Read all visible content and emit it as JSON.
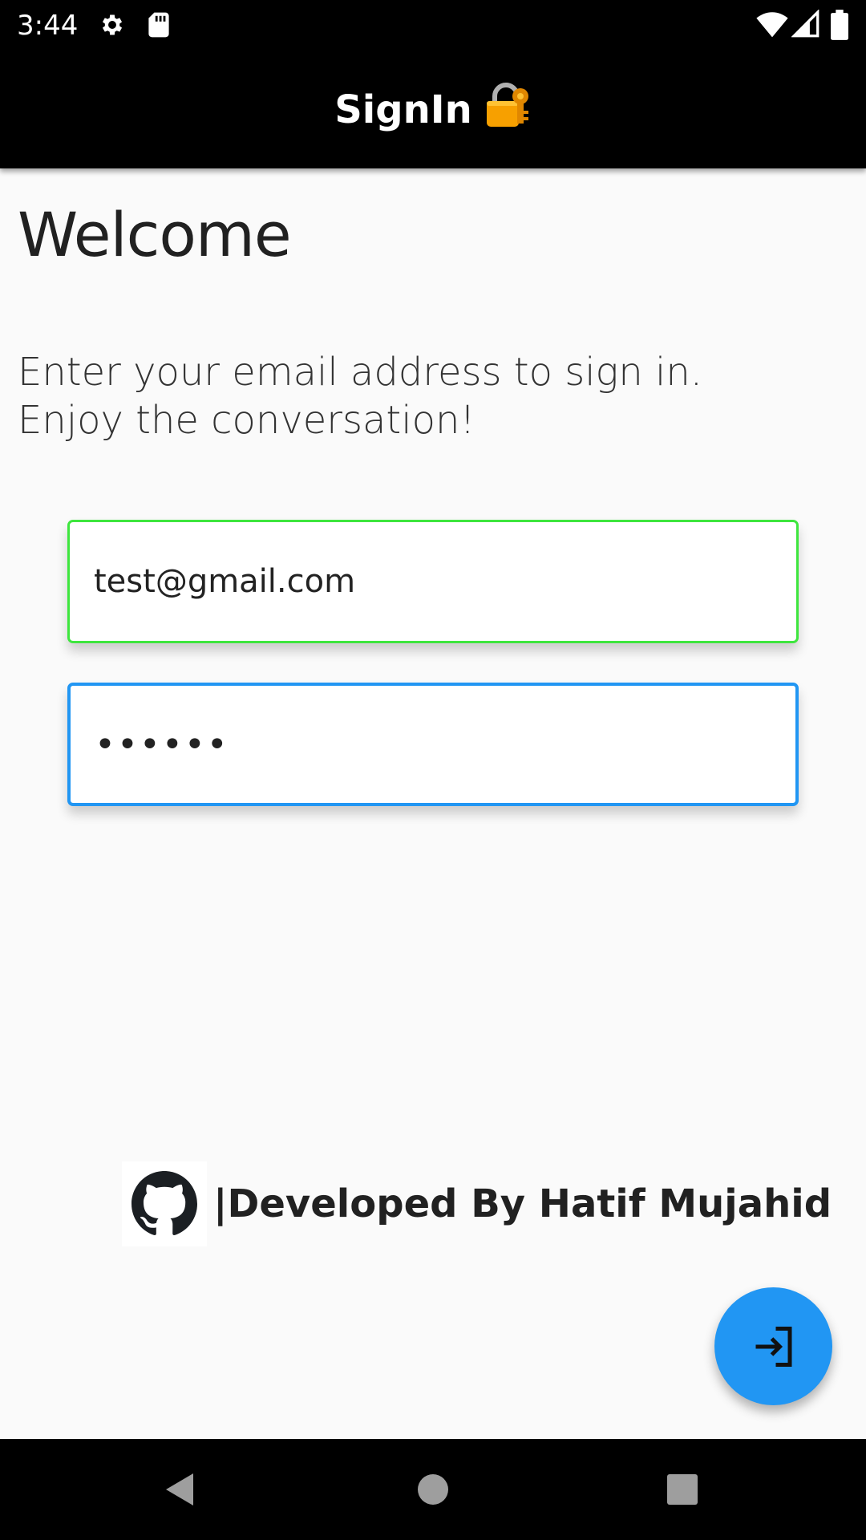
{
  "status_bar": {
    "time": "3:44",
    "left_icons": [
      "settings-icon",
      "sd-card-icon"
    ],
    "right_icons": [
      "wifi-icon",
      "signal-icon",
      "battery-icon"
    ]
  },
  "app_bar": {
    "title": "SignIn",
    "title_icon": "lock-key-icon"
  },
  "main": {
    "heading": "Welcome",
    "subtitle_line1": "Enter your email address to sign in.",
    "subtitle_line2": "Enjoy the conversation!"
  },
  "form": {
    "email_value": "test@gmail.com",
    "password_value": "••••••"
  },
  "footer": {
    "icon": "github-icon",
    "text": "|Developed By Hatif Mujahid"
  },
  "fab": {
    "icon": "login-arrow-icon"
  },
  "nav_bar": {
    "buttons": [
      "back",
      "home",
      "recents"
    ]
  },
  "colors": {
    "accent": "#2196f3",
    "email_border": "#3ee63e",
    "bar_background": "#000000",
    "page_background": "#fafafa"
  }
}
